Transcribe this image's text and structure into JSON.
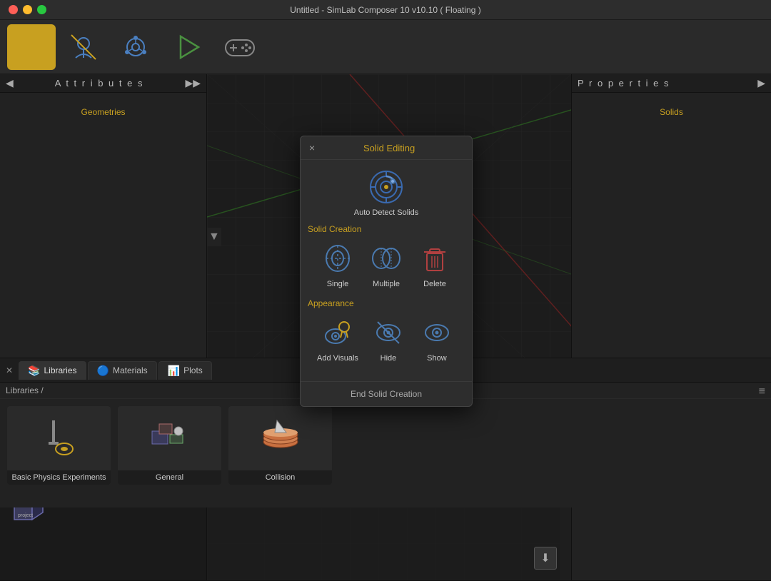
{
  "window": {
    "title": "Untitled - SimLab Composer 10 v10.10 ( Floating )"
  },
  "titlebar": {
    "close_label": "",
    "minimize_label": "",
    "maximize_label": ""
  },
  "toolbar": {
    "buttons": [
      {
        "id": "settings",
        "icon": "⚙",
        "active": true
      },
      {
        "id": "model",
        "icon": "🚶",
        "active": false
      },
      {
        "id": "connections",
        "icon": "🔧",
        "active": false
      },
      {
        "id": "play",
        "icon": "▶",
        "active": false
      },
      {
        "id": "gamepad",
        "icon": "🎮",
        "active": false
      }
    ]
  },
  "attributes_panel": {
    "title": "A t t r i b u t e s",
    "section_label": "Geometries"
  },
  "properties_panel": {
    "title": "P r o p e r t i e s",
    "section_label": "Solids"
  },
  "bottom_panel": {
    "tabs": [
      {
        "id": "libraries",
        "label": "Libraries",
        "icon": "📚",
        "active": true
      },
      {
        "id": "materials",
        "label": "Materials",
        "icon": "🔵",
        "active": false
      },
      {
        "id": "plots",
        "label": "Plots",
        "icon": "📊",
        "active": false
      }
    ],
    "breadcrumb": "Libraries  /",
    "items": [
      {
        "id": "basic-physics",
        "label": "Basic Physics Experiments",
        "icon": "🔬"
      },
      {
        "id": "general",
        "label": "General",
        "icon": "⚙"
      },
      {
        "id": "collision",
        "label": "Collision",
        "icon": "💿"
      }
    ]
  },
  "dialog": {
    "title": "Solid Editing",
    "close_button": "×",
    "sections": [
      {
        "id": "auto-detect",
        "items": [
          {
            "id": "auto-detect-solids",
            "label": "Auto Detect Solids",
            "icon": "target"
          }
        ]
      },
      {
        "id": "solid-creation",
        "label": "Solid Creation",
        "items": [
          {
            "id": "single",
            "label": "Single",
            "icon": "single"
          },
          {
            "id": "multiple",
            "label": "Multiple",
            "icon": "multiple"
          },
          {
            "id": "delete",
            "label": "Delete",
            "icon": "delete"
          }
        ]
      },
      {
        "id": "appearance",
        "label": "Appearance",
        "items": [
          {
            "id": "add-visuals",
            "label": "Add Visuals",
            "icon": "visuals"
          },
          {
            "id": "hide",
            "label": "Hide",
            "icon": "hide"
          },
          {
            "id": "show",
            "label": "Show",
            "icon": "show"
          }
        ]
      }
    ],
    "footer_label": "End Solid Creation"
  },
  "viewport": {
    "cube_label": "project"
  }
}
